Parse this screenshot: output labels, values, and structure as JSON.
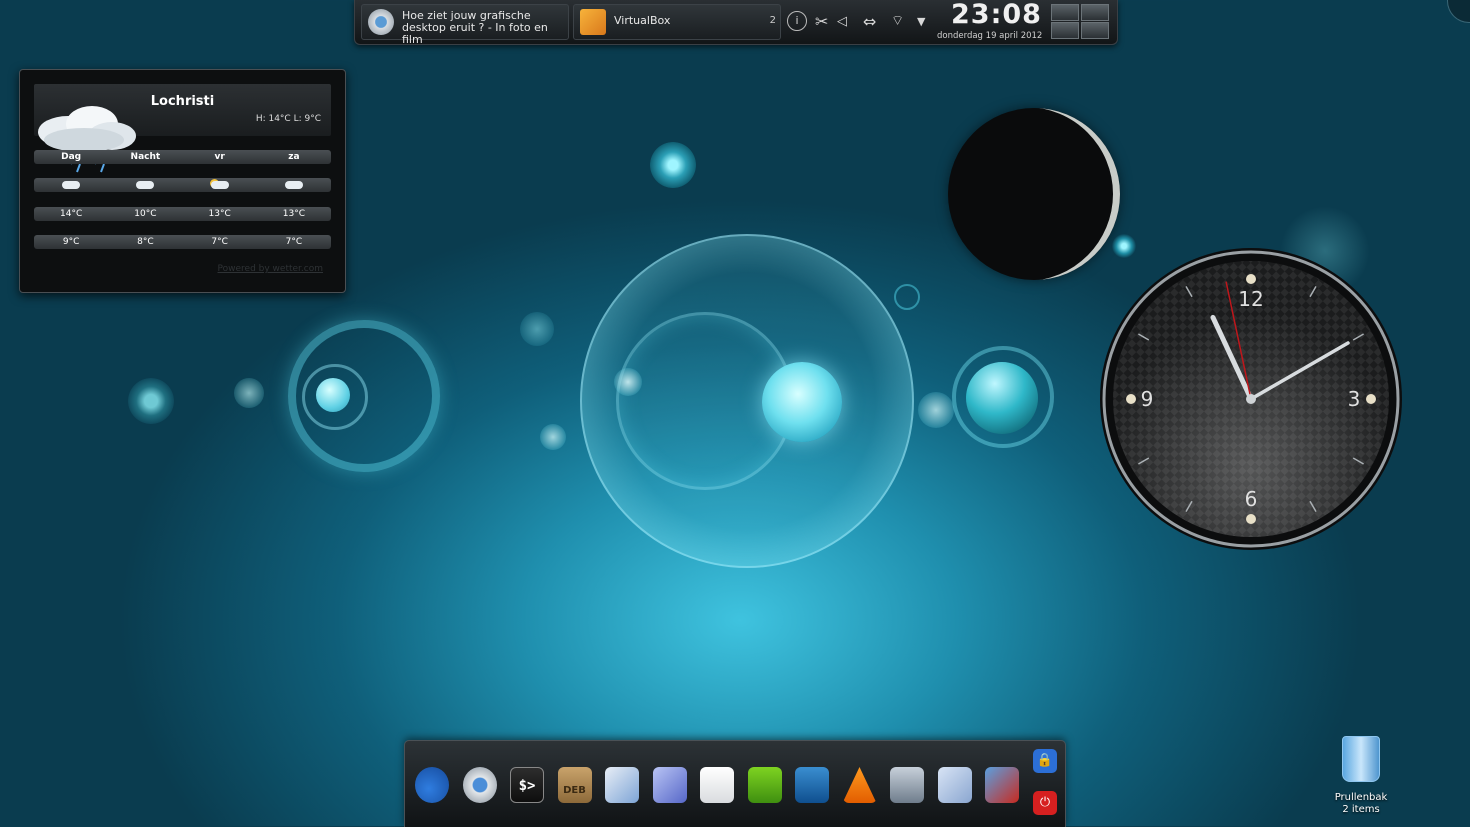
{
  "panel": {
    "tasks": [
      {
        "title": "Hoe ziet jouw grafische\ndesktop eruit ? - In foto en film",
        "icon": "chrome-icon"
      },
      {
        "title": "VirtualBox",
        "icon": "virtualbox-icon",
        "badge": "2"
      }
    ],
    "tray_icons": [
      "info-icon",
      "scissors-icon",
      "volume-icon",
      "network-icon",
      "wifi-icon",
      "arrow-down-icon"
    ],
    "clock_time": "23:08",
    "clock_date": "donderdag 19 april 2012"
  },
  "weather": {
    "city": "Lochristi",
    "high_low": "H: 14°C L: 9°C",
    "days": [
      "Dag",
      "Nacht",
      "vr",
      "za"
    ],
    "highs": [
      "14°C",
      "10°C",
      "13°C",
      "13°C"
    ],
    "lows": [
      "9°C",
      "8°C",
      "7°C",
      "7°C"
    ],
    "powered": "Powered by wetter.com"
  },
  "clock": {
    "numbers": [
      "12",
      "3",
      "6",
      "9"
    ],
    "hour": 11,
    "minute": 10,
    "second": 58
  },
  "dock": {
    "items": [
      "gnome-foot-icon",
      "chrome-icon",
      "terminal-icon",
      "deb-package-icon",
      "disc-burner-icon",
      "cube-icon",
      "document-icon",
      "ubuntu-tweak-icon",
      "system-monitor-icon",
      "vlc-icon",
      "speaker-icon",
      "mail-icon",
      "remote-desktop-icon",
      "lock-icon",
      "power-icon"
    ],
    "terminal_label": "$>",
    "deb_label": "DEB"
  },
  "trash": {
    "label": "Prullenbak",
    "count": "2 items"
  },
  "colors": {
    "accent": "#3fc3df",
    "panel": "#1a1e21"
  }
}
